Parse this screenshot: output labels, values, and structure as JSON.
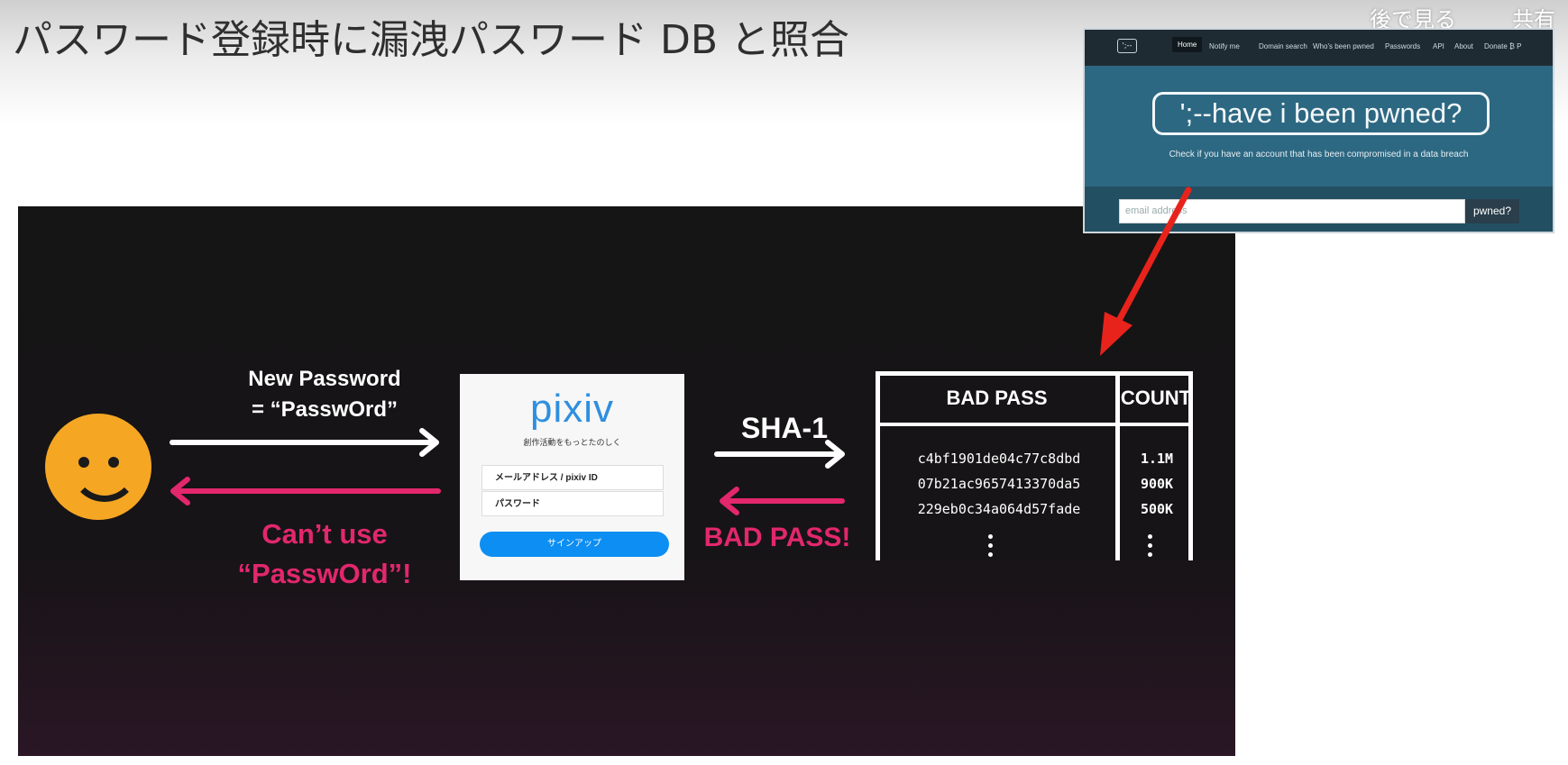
{
  "video": {
    "slide_title": "パスワード登録時に漏洩パスワード DB と照合",
    "watch_later": "後で見る",
    "share": "共有"
  },
  "slide": {
    "new_password_line1": "New Password",
    "new_password_line2": "= “PasswOrd”",
    "cant_use_line1": "Can’t use",
    "cant_use_line2": "“PasswOrd”!",
    "sha1": "SHA-1",
    "bad_pass_msg": "BAD PASS!"
  },
  "pixiv": {
    "logo": "pixiv",
    "tagline": "創作活動をもっとたのしく",
    "email_field": "メールアドレス / pixiv ID",
    "password_field": "パスワード",
    "signup_button": "サインアップ"
  },
  "bad_pass_table": {
    "headers": [
      "BAD PASS",
      "COUNT"
    ],
    "rows": [
      {
        "hash": "c4bf1901de04c77c8dbd",
        "count": "1.1M"
      },
      {
        "hash": "07b21ac9657413370da5",
        "count": "900K"
      },
      {
        "hash": "229eb0c34a064d57fade",
        "count": "500K"
      }
    ]
  },
  "hibp": {
    "logo": "';--",
    "nav": [
      "Home",
      "Notify me",
      "Domain search",
      "Who's been pwned",
      "Passwords",
      "API",
      "About",
      "Donate ₿ P"
    ],
    "title": "';--have i been pwned?",
    "subtitle": "Check if you have an account that has been compromised in a data breach",
    "email_placeholder": "email address",
    "pwned_button": "pwned?"
  },
  "colors": {
    "accent_pink": "#e2276d",
    "smiley_yellow": "#f5a623",
    "pixiv_blue": "#0d8ef2",
    "arrow_red": "#e8231c"
  }
}
